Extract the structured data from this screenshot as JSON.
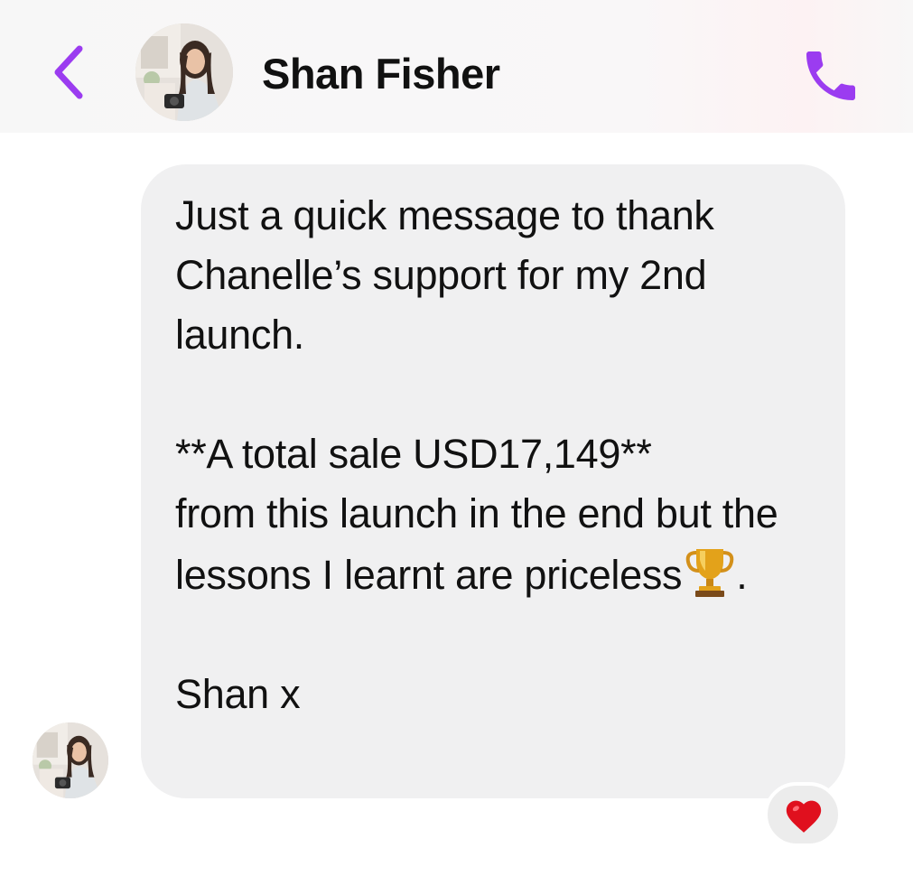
{
  "header": {
    "contact_name": "Shan Fisher",
    "back_icon": "chevron-left-icon",
    "call_icon": "phone-icon",
    "accent_color": "#9b3cf0"
  },
  "message": {
    "paragraph_1": "Just a quick message to thank Chanelle’s support for my 2nd launch.",
    "paragraph_2_line_1": "**A total sale USD17,149**",
    "paragraph_2_rest": "from this launch in the end but the lessons I learnt are priceless",
    "trophy_icon": "trophy-icon",
    "paragraph_2_end": ".",
    "signature": "Shan x",
    "bubble_color": "#f0f0f1"
  },
  "reaction": {
    "icon": "heart-icon",
    "color": "#e0101e"
  }
}
